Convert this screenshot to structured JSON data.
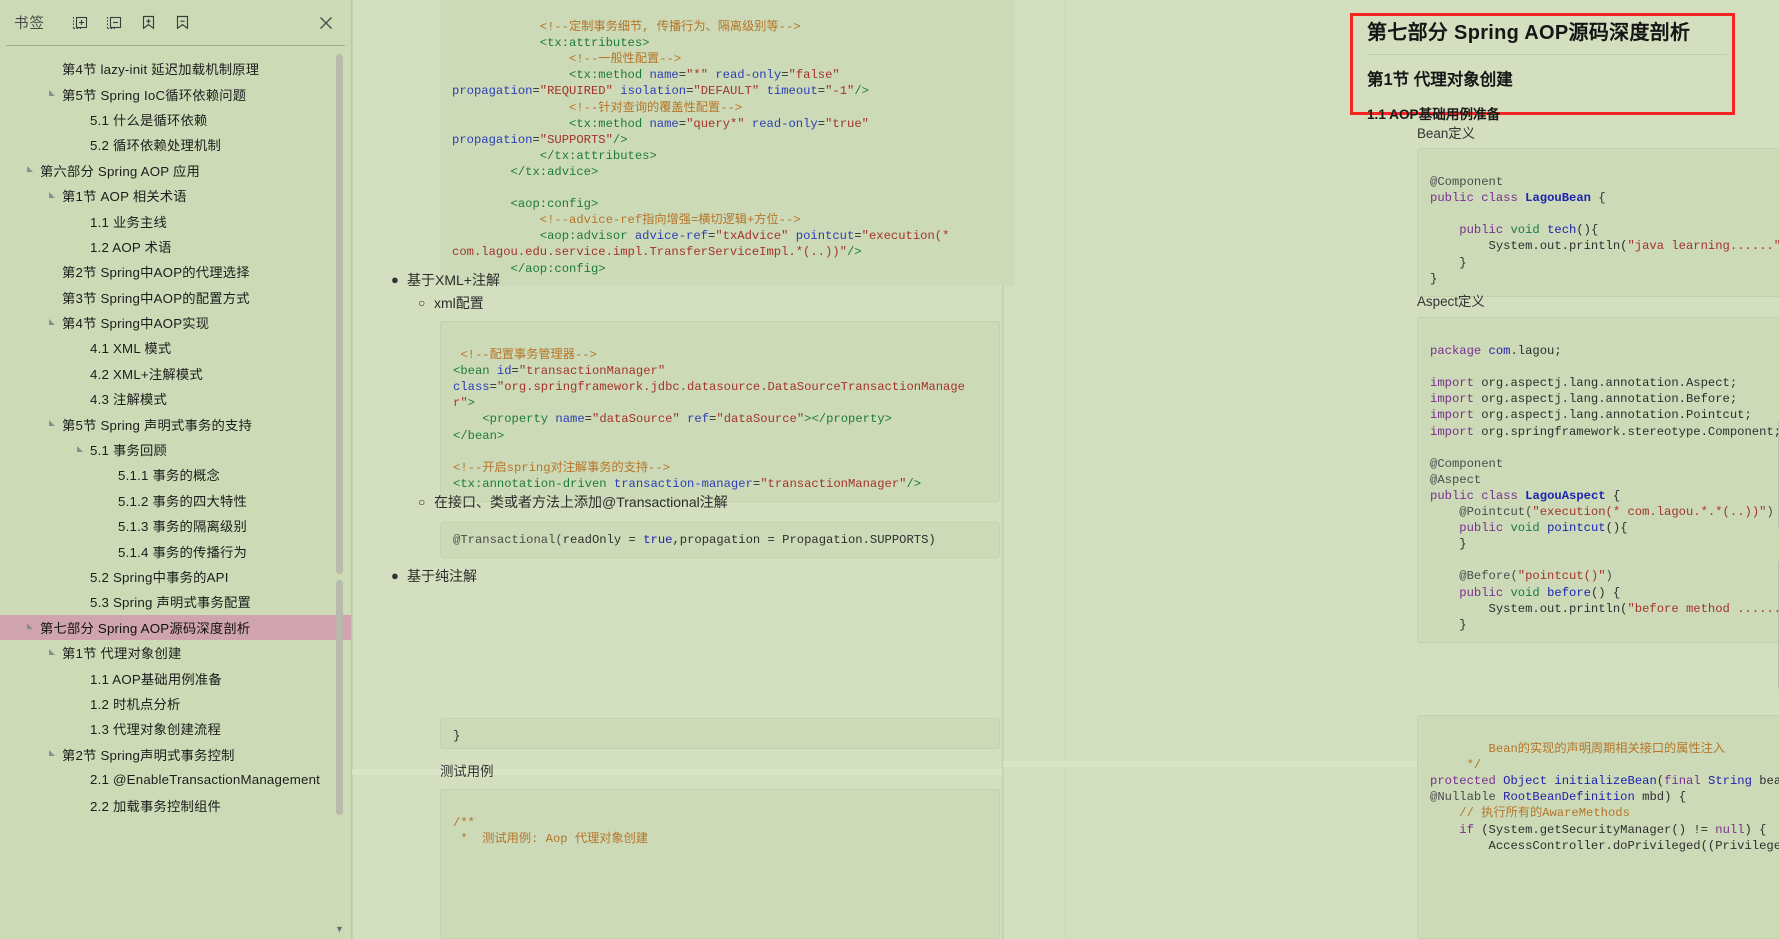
{
  "sidebar": {
    "title": "书签",
    "toolbar": [
      {
        "name": "expand-all-icon",
        "label": "展开全部"
      },
      {
        "name": "collapse-all-icon",
        "label": "折叠全部"
      },
      {
        "name": "add-bookmark-icon",
        "label": "添加书签"
      },
      {
        "name": "remove-bookmark-icon",
        "label": "删除书签"
      }
    ],
    "close_label": "×",
    "items": [
      {
        "label": "第4节 lazy-init 延迟加载机制原理",
        "level": 1,
        "caret": false,
        "selected": false
      },
      {
        "label": "第5节 Spring IoC循环依赖问题",
        "level": 1,
        "caret": true,
        "selected": false
      },
      {
        "label": "5.1 什么是循环依赖",
        "level": 2,
        "caret": false,
        "selected": false
      },
      {
        "label": "5.2 循环依赖处理机制",
        "level": 2,
        "caret": false,
        "selected": false
      },
      {
        "label": "第六部分 Spring AOP 应用",
        "level": 0,
        "caret": true,
        "selected": false
      },
      {
        "label": "第1节 AOP 相关术语",
        "level": 1,
        "caret": true,
        "selected": false
      },
      {
        "label": "1.1 业务主线",
        "level": 2,
        "caret": false,
        "selected": false
      },
      {
        "label": "1.2 AOP 术语",
        "level": 2,
        "caret": false,
        "selected": false
      },
      {
        "label": "第2节 Spring中AOP的代理选择",
        "level": 1,
        "caret": false,
        "selected": false
      },
      {
        "label": "第3节 Spring中AOP的配置方式",
        "level": 1,
        "caret": false,
        "selected": false
      },
      {
        "label": "第4节 Spring中AOP实现",
        "level": 1,
        "caret": true,
        "selected": false
      },
      {
        "label": "4.1 XML 模式",
        "level": 2,
        "caret": false,
        "selected": false
      },
      {
        "label": "4.2 XML+注解模式",
        "level": 2,
        "caret": false,
        "selected": false
      },
      {
        "label": "4.3 注解模式",
        "level": 2,
        "caret": false,
        "selected": false
      },
      {
        "label": "第5节 Spring 声明式事务的支持",
        "level": 1,
        "caret": true,
        "selected": false
      },
      {
        "label": "5.1 事务回顾",
        "level": 2,
        "caret": true,
        "selected": false
      },
      {
        "label": "5.1.1 事务的概念",
        "level": 3,
        "caret": false,
        "selected": false
      },
      {
        "label": "5.1.2 事务的四大特性",
        "level": 3,
        "caret": false,
        "selected": false
      },
      {
        "label": "5.1.3 事务的隔离级别",
        "level": 3,
        "caret": false,
        "selected": false
      },
      {
        "label": "5.1.4 事务的传播行为",
        "level": 3,
        "caret": false,
        "selected": false
      },
      {
        "label": "5.2 Spring中事务的API",
        "level": 2,
        "caret": false,
        "selected": false
      },
      {
        "label": "5.3 Spring 声明式事务配置",
        "level": 2,
        "caret": false,
        "selected": false
      },
      {
        "label": "第七部分 Spring AOP源码深度剖析",
        "level": 0,
        "caret": true,
        "selected": true
      },
      {
        "label": "第1节 代理对象创建",
        "level": 1,
        "caret": true,
        "selected": false
      },
      {
        "label": "1.1 AOP基础用例准备",
        "level": 2,
        "caret": false,
        "selected": false
      },
      {
        "label": "1.2 时机点分析",
        "level": 2,
        "caret": false,
        "selected": false
      },
      {
        "label": "1.3 代理对象创建流程",
        "level": 2,
        "caret": false,
        "selected": false
      },
      {
        "label": "第2节 Spring声明式事务控制",
        "level": 1,
        "caret": true,
        "selected": false
      },
      {
        "label": "2.1 @EnableTransactionManagement",
        "level": 2,
        "caret": false,
        "selected": false
      },
      {
        "label": "2.2 加载事务控制组件",
        "level": 2,
        "caret": false,
        "selected": false
      }
    ]
  },
  "colors": {
    "page_background": "#d3dfbe",
    "sidebar_background": "#ccdbb6",
    "selection_highlight": "#d0a4ae",
    "annotation_box": "#f72323",
    "code_background": "#ccdab7"
  },
  "left_page": {
    "code_xml_top_lines": [
      "<!--定制事务细节, 传播行为、隔离级别等-->",
      "    <tx:attributes>",
      "        <!--一般性配置-->",
      "        <tx:method name=\"*\" read-only=\"false\"",
      "propagation=\"REQUIRED\" isolation=\"DEFAULT\" timeout=\"-1\"/>",
      "        <!--针对查询的覆盖性配置-->",
      "        <tx:method name=\"query*\" read-only=\"true\"",
      "propagation=\"SUPPORTS\"/>",
      "    </tx:attributes>",
      "</tx:advice>",
      "",
      "<aop:config>",
      "    <!--advice-ref指向增强=横切逻辑+方位-->",
      "    <aop:advisor advice-ref=\"txAdvice\" pointcut=\"execution(*",
      "com.lagou.edu.service.impl.TransferServiceImpl.*(..))\"/>",
      "</aop:config>"
    ],
    "bullet_xml_annotation": "基于XML+注解",
    "sub_xml_config": "xml配置",
    "code_xml_bean_lines": [
      " <!--配置事务管理器-->",
      "<bean id=\"transactionManager\"",
      "class=\"org.springframework.jdbc.datasource.DataSourceTransactionManager\">",
      "    <property name=\"dataSource\" ref=\"dataSource\"></property>",
      "</bean>",
      "",
      "<!--开启spring对注解事务的支持-->",
      "<tx:annotation-driven transaction-manager=\"transactionManager\"/>"
    ],
    "sub_transactional": "在接口、类或者方法上添加@Transactional注解",
    "code_transactional": "@Transactional(readOnly = true,propagation = Propagation.SUPPORTS)",
    "bullet_pure_annotation": "基于纯注解",
    "code_closing_brace": "}",
    "caption_test_case": "测试用例",
    "code_test_case_lines": [
      "/**",
      " *  测试用例: Aop 代理对象创建"
    ]
  },
  "right_page": {
    "heading_part": "第七部分 Spring AOP源码深度剖析",
    "heading_section": "第1节 代理对象创建",
    "heading_sub": "1.1 AOP基础用例准备",
    "caption_bean": "Bean定义",
    "code_bean_lines": [
      "@Component",
      "public class LagouBean {",
      "",
      "    public void tech(){",
      "        System.out.println(\"java learning......\");",
      "    }",
      "}"
    ],
    "caption_aspect": "Aspect定义",
    "code_aspect_lines": [
      "package com.lagou;",
      "",
      "import org.aspectj.lang.annotation.Aspect;",
      "import org.aspectj.lang.annotation.Before;",
      "import org.aspectj.lang.annotation.Pointcut;",
      "import org.springframework.stereotype.Component;",
      "",
      "@Component",
      "@Aspect",
      "public class LagouAspect {",
      "    @Pointcut(\"execution(* com.lagou.*.*(..))\")",
      "    public void pointcut(){",
      "    }",
      "",
      "    @Before(\"pointcut()\")",
      "    public void before() {",
      "        System.out.println(\"before method ......\");",
      "    }"
    ],
    "code_initialize_lines": [
      "    Bean的实现的声明周期相关接口的属性注入",
      " */",
      "protected Object initializeBean(final String beanName, final Object bean,",
      "@Nullable RootBeanDefinition mbd) {",
      "    // 执行所有的AwareMethods",
      "    if (System.getSecurityManager() != null) {",
      "        AccessController.doPrivileged((PrivilegedAction<Object>) () -> {"
    ]
  }
}
